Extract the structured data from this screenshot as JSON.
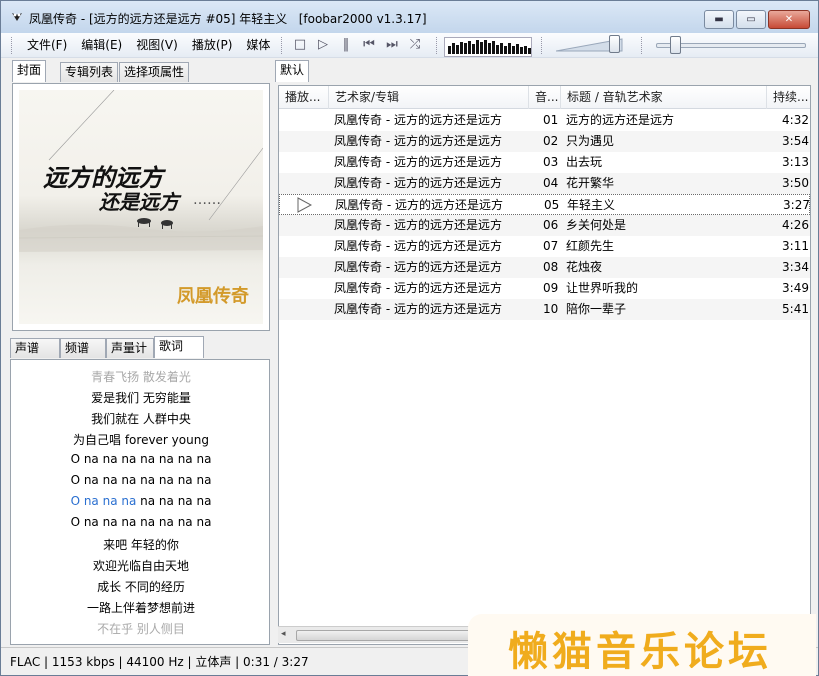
{
  "window": {
    "title": "凤凰传奇 - [远方的远方还是远方 #05] 年轻主义   [foobar2000 v1.3.17]",
    "buttons": {
      "minimize": "▬",
      "maximize": "▭",
      "close": "✕"
    }
  },
  "menu": [
    "文件(F)",
    "编辑(E)",
    "视图(V)",
    "播放(P)",
    "媒体"
  ],
  "playback_icons": [
    "stop-icon",
    "play-icon",
    "pause-icon",
    "prev-icon",
    "next-icon",
    "random-icon"
  ],
  "playback_glyphs": [
    "□",
    "▷",
    "‖",
    "⏮",
    "⏭",
    "⤮"
  ],
  "visualizer_levels": [
    0.55,
    0.75,
    0.6,
    0.8,
    0.7,
    0.85,
    0.65,
    0.9,
    0.8,
    0.95,
    0.7,
    0.85,
    0.6,
    0.75,
    0.55,
    0.7,
    0.5,
    0.65,
    0.45,
    0.5,
    0.4
  ],
  "left_tabs_top": [
    "封面",
    "专辑列表",
    "选择项属性"
  ],
  "left_tabs_bottom": [
    "声谱",
    "频谱",
    "声量计",
    "歌词"
  ],
  "cover": {
    "line1": "远方的远方",
    "line2": "还是远方",
    "dots": "……",
    "brand": "凤凰传奇"
  },
  "lyrics": [
    {
      "text": "青春飞扬 散发着光",
      "state": "faded"
    },
    {
      "text": "爱是我们 无穷能量",
      "state": "normal"
    },
    {
      "text": "我们就在 人群中央",
      "state": "normal"
    },
    {
      "text": "为自己唱 forever young",
      "state": "normal"
    },
    {
      "text": "O na na na na na na na",
      "state": "normal"
    },
    {
      "text": "O na na na na na na na",
      "state": "normal"
    },
    {
      "text_hl": "O na na na",
      "text_rest": " na na na na",
      "state": "current"
    },
    {
      "text": "O na na na na na na na",
      "state": "normal"
    },
    {
      "text": "来吧 年轻的你",
      "state": "normal"
    },
    {
      "text": "欢迎光临自由天地",
      "state": "normal"
    },
    {
      "text": "成长 不同的经历",
      "state": "normal"
    },
    {
      "text": "一路上伴着梦想前进",
      "state": "normal"
    },
    {
      "text": "不在乎 别人侧目",
      "state": "faded"
    }
  ],
  "playlist_tab": "默认",
  "columns": [
    "播放...",
    "艺术家/专辑",
    "音...",
    "标题 / 音轨艺术家",
    "持续..."
  ],
  "tracks": [
    {
      "artist_album": "凤凰传奇 - 远方的远方还是远方",
      "no": "01",
      "title": "远方的远方还是远方",
      "duration": "4:32"
    },
    {
      "artist_album": "凤凰传奇 - 远方的远方还是远方",
      "no": "02",
      "title": "只为遇见",
      "duration": "3:54"
    },
    {
      "artist_album": "凤凰传奇 - 远方的远方还是远方",
      "no": "03",
      "title": "出去玩",
      "duration": "3:13"
    },
    {
      "artist_album": "凤凰传奇 - 远方的远方还是远方",
      "no": "04",
      "title": "花开繁华",
      "duration": "3:50"
    },
    {
      "artist_album": "凤凰传奇 - 远方的远方还是远方",
      "no": "05",
      "title": "年轻主义",
      "duration": "3:27",
      "playing": true
    },
    {
      "artist_album": "凤凰传奇 - 远方的远方还是远方",
      "no": "06",
      "title": "乡关何处是",
      "duration": "4:26"
    },
    {
      "artist_album": "凤凰传奇 - 远方的远方还是远方",
      "no": "07",
      "title": "红颜先生",
      "duration": "3:11"
    },
    {
      "artist_album": "凤凰传奇 - 远方的远方还是远方",
      "no": "08",
      "title": "花烛夜",
      "duration": "3:34"
    },
    {
      "artist_album": "凤凰传奇 - 远方的远方还是远方",
      "no": "09",
      "title": "让世界听我的",
      "duration": "3:49"
    },
    {
      "artist_album": "凤凰传奇 - 远方的远方还是远方",
      "no": "10",
      "title": "陪你一辈子",
      "duration": "5:41"
    }
  ],
  "status": "FLAC | 1153 kbps | 44100 Hz | 立体声 | 0:31 / 3:27",
  "watermark": "懒猫音乐论坛",
  "volume_level": 0.85,
  "seek_position": 0.15
}
